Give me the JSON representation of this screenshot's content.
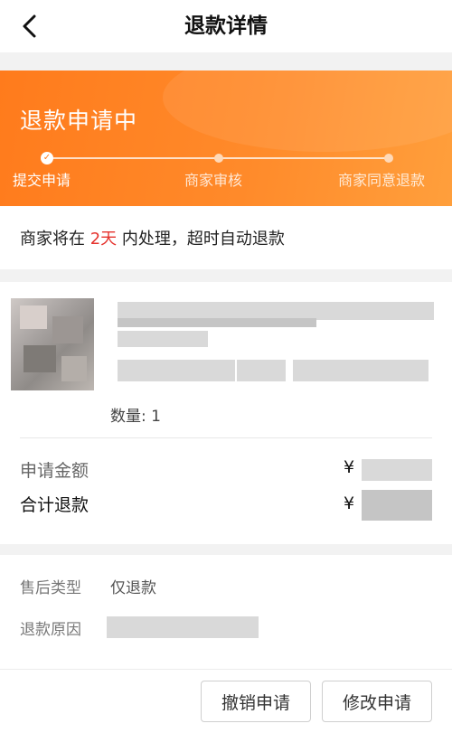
{
  "header": {
    "title": "退款详情"
  },
  "status": {
    "title": "退款申请中",
    "steps": [
      "提交申请",
      "商家审核",
      "商家同意退款"
    ],
    "active_step": 0
  },
  "notice": {
    "prefix": "商家将在 ",
    "highlight": "2天",
    "suffix": " 内处理，超时自动退款"
  },
  "product": {
    "quantity_label": "数量: 1"
  },
  "amounts": {
    "apply_label": "申请金额",
    "total_label": "合计退款",
    "currency": "¥"
  },
  "aftersale": {
    "type_label": "售后类型",
    "type_value": "仅退款",
    "reason_label": "退款原因"
  },
  "actions": {
    "cancel": "撤销申请",
    "modify": "修改申请"
  },
  "colors": {
    "accent": "#ff7b1c",
    "highlight": "#e5322d"
  }
}
